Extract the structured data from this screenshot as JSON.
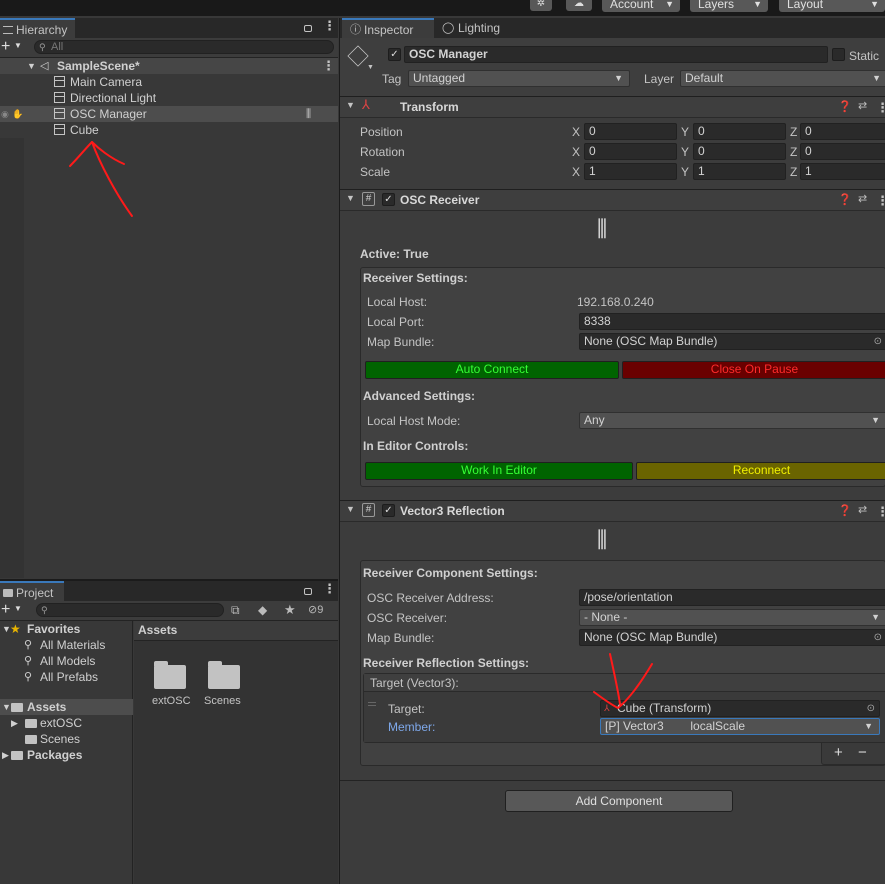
{
  "toolbar": {
    "account": "Account",
    "layers": "Layers",
    "layout": "Layout"
  },
  "hierarchy": {
    "tab": "Hierarchy",
    "search_placeholder": "All",
    "scene": "SampleScene*",
    "items": [
      "Main Camera",
      "Directional Light",
      "OSC Manager",
      "Cube"
    ]
  },
  "project": {
    "tab": "Project",
    "hidden_count": "9",
    "favorites": "Favorites",
    "favorite_items": [
      "All Materials",
      "All Models",
      "All Prefabs"
    ],
    "assets": "Assets",
    "asset_children": [
      "extOSC",
      "Scenes"
    ],
    "packages": "Packages",
    "content_header": "Assets",
    "content_folders": [
      "extOSC",
      "Scenes"
    ]
  },
  "inspector": {
    "tabs": [
      "Inspector",
      "Lighting"
    ],
    "object_name": "OSC Manager",
    "static_label": "Static",
    "tag_label": "Tag",
    "tag_value": "Untagged",
    "layer_label": "Layer",
    "layer_value": "Default",
    "transform": {
      "title": "Transform",
      "rows": [
        {
          "label": "Position",
          "x": "0",
          "y": "0",
          "z": "0"
        },
        {
          "label": "Rotation",
          "x": "0",
          "y": "0",
          "z": "0"
        },
        {
          "label": "Scale",
          "x": "1",
          "y": "1",
          "z": "1"
        }
      ],
      "axis": [
        "X",
        "Y",
        "Z"
      ]
    },
    "receiver": {
      "title": "OSC Receiver",
      "active": "Active: True",
      "settings_label": "Receiver Settings:",
      "local_host_label": "Local Host:",
      "local_host_value": "192.168.0.240",
      "local_port_label": "Local Port:",
      "local_port_value": "8338",
      "map_bundle_label": "Map Bundle:",
      "map_bundle_value": "None (OSC Map Bundle)",
      "auto_connect": "Auto Connect",
      "close_on_pause": "Close On Pause",
      "advanced_label": "Advanced Settings:",
      "host_mode_label": "Local Host Mode:",
      "host_mode_value": "Any",
      "editor_controls_label": "In Editor Controls:",
      "work_in_editor": "Work In Editor",
      "reconnect": "Reconnect"
    },
    "reflection": {
      "title": "Vector3 Reflection",
      "component_settings_label": "Receiver Component Settings:",
      "address_label": "OSC Receiver Address:",
      "address_value": "/pose/orientation",
      "receiver_label": "OSC Receiver:",
      "receiver_value": "- None -",
      "map_bundle_label": "Map Bundle:",
      "map_bundle_value": "None (OSC Map Bundle)",
      "reflection_settings_label": "Receiver Reflection Settings:",
      "target_header": "Target (Vector3):",
      "target_label": "Target:",
      "target_value": "Cube (Transform)",
      "member_label": "Member:",
      "member_value": "[P] Vector3        localScale",
      "plus": "+",
      "minus": "−"
    },
    "add_component": "Add Component"
  },
  "colors": {
    "accent": "#3a79bb",
    "annotation": "#ff1a1a",
    "green_button": "#006400",
    "dark_red_button": "#6a0000",
    "olive_button": "#6a6400"
  }
}
